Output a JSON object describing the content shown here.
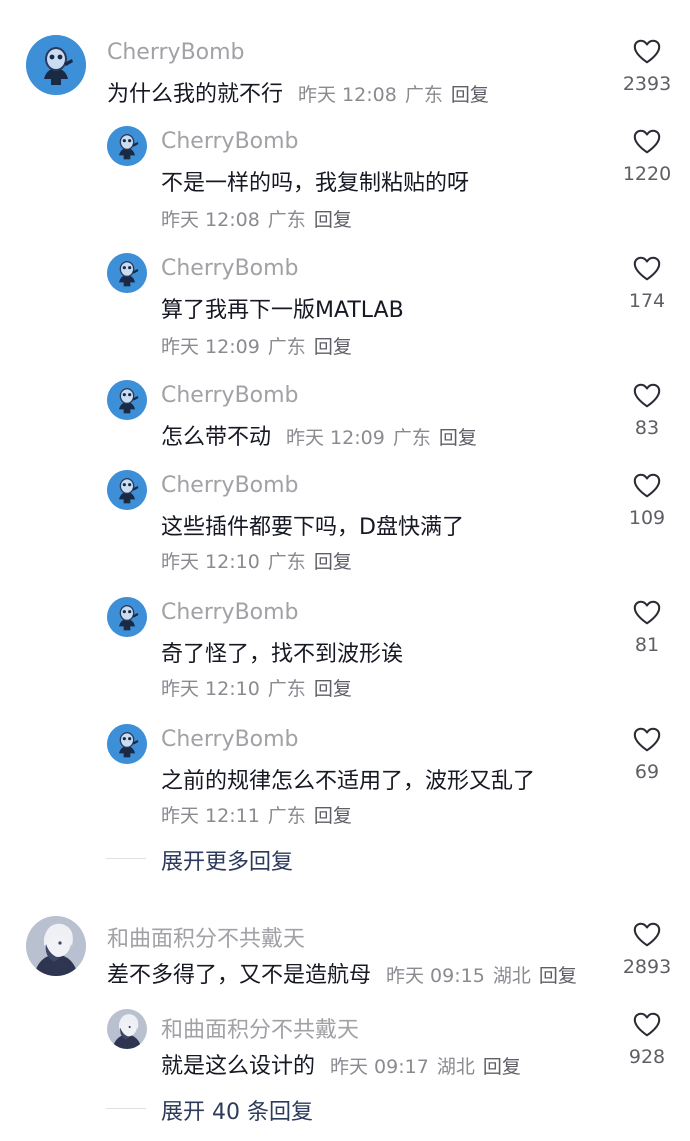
{
  "threads": [
    {
      "main": {
        "username": "CherryBomb",
        "text": "为什么我的就不行",
        "time": "昨天 12:08",
        "location": "广东",
        "reply_label": "回复",
        "likes": "2393",
        "avatar": "blue-character-avatar"
      },
      "replies": [
        {
          "username": "CherryBomb",
          "text": "不是一样的吗，我复制粘贴的呀",
          "time": "昨天 12:08",
          "location": "广东",
          "reply_label": "回复",
          "likes": "1220"
        },
        {
          "username": "CherryBomb",
          "text": "算了我再下一版MATLAB",
          "time": "昨天 12:09",
          "location": "广东",
          "reply_label": "回复",
          "likes": "174"
        },
        {
          "username": "CherryBomb",
          "text": "怎么带不动",
          "time": "昨天 12:09",
          "location": "广东",
          "reply_label": "回复",
          "likes": "83"
        },
        {
          "username": "CherryBomb",
          "text": "这些插件都要下吗，D盘快满了",
          "time": "昨天 12:10",
          "location": "广东",
          "reply_label": "回复",
          "likes": "109"
        },
        {
          "username": "CherryBomb",
          "text": "奇了怪了，找不到波形诶",
          "time": "昨天 12:10",
          "location": "广东",
          "reply_label": "回复",
          "likes": "81"
        },
        {
          "username": "CherryBomb",
          "text": "之前的规律怎么不适用了，波形又乱了",
          "time": "昨天 12:11",
          "location": "广东",
          "reply_label": "回复",
          "likes": "69"
        }
      ],
      "expand_label": "展开更多回复"
    },
    {
      "main": {
        "username": "和曲面积分不共戴天",
        "text": "差不多得了，又不是造航母",
        "time": "昨天 09:15",
        "location": "湖北",
        "reply_label": "回复",
        "likes": "2893",
        "avatar": "anime-character-avatar"
      },
      "replies": [
        {
          "username": "和曲面积分不共戴天",
          "text": "就是这么设计的",
          "time": "昨天 09:17",
          "location": "湖北",
          "reply_label": "回复",
          "likes": "928"
        }
      ],
      "expand_label": "展开 40 条回复"
    }
  ],
  "colors": {
    "username": "#a1a1a6",
    "text": "#161823",
    "meta": "#8a8b91",
    "expand": "#2c3b5b",
    "avatar_blue": "#3a8fd6"
  }
}
